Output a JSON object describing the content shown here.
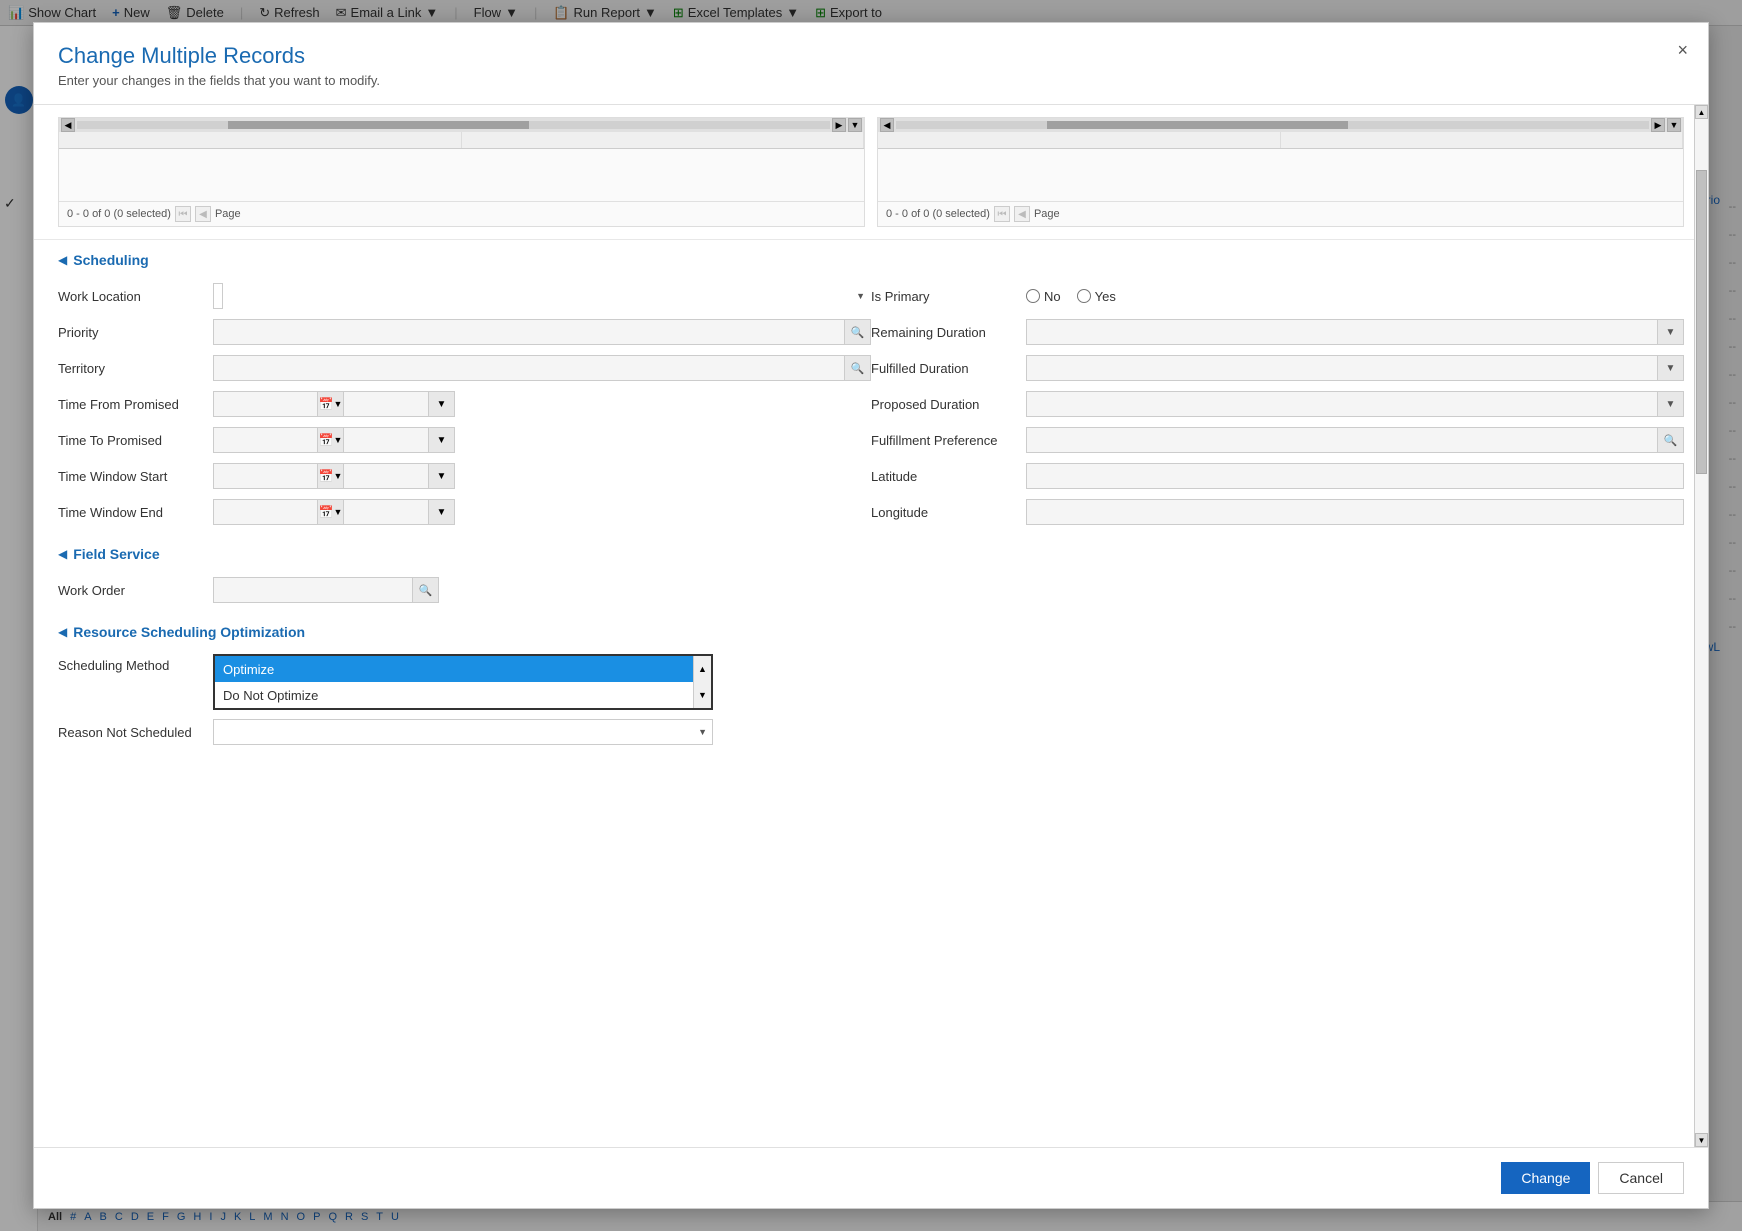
{
  "toolbar": {
    "show_chart": "Show Chart",
    "new": "New",
    "delete": "Delete",
    "refresh": "Refresh",
    "email_link": "Email a Link",
    "flow": "Flow",
    "run_report": "Run Report",
    "excel_templates": "Excel Templates",
    "export_to": "Export to"
  },
  "modal": {
    "title": "Change Multiple Records",
    "subtitle": "Enter your changes in the fields that you want to modify.",
    "close_label": "×",
    "lookup_panel1": {
      "pagination": "0 - 0 of 0 (0 selected)",
      "page_label": "Page"
    },
    "lookup_panel2": {
      "pagination": "0 - 0 of 0 (0 selected)",
      "page_label": "Page"
    },
    "sections": {
      "scheduling": {
        "title": "Scheduling",
        "fields": {
          "work_location": {
            "label": "Work Location",
            "value": ""
          },
          "is_primary": {
            "label": "Is Primary",
            "no_label": "No",
            "yes_label": "Yes"
          },
          "priority": {
            "label": "Priority",
            "value": ""
          },
          "remaining_duration": {
            "label": "Remaining Duration",
            "value": ""
          },
          "territory": {
            "label": "Territory",
            "value": ""
          },
          "fulfilled_duration": {
            "label": "Fulfilled Duration",
            "value": ""
          },
          "time_from_promised": {
            "label": "Time From Promised",
            "date_value": "",
            "time_value": ""
          },
          "proposed_duration": {
            "label": "Proposed Duration",
            "value": ""
          },
          "time_to_promised": {
            "label": "Time To Promised",
            "date_value": "",
            "time_value": ""
          },
          "fulfillment_preference": {
            "label": "Fulfillment Preference",
            "value": ""
          },
          "time_window_start": {
            "label": "Time Window Start",
            "date_value": "",
            "time_value": ""
          },
          "latitude": {
            "label": "Latitude",
            "value": ""
          },
          "time_window_end": {
            "label": "Time Window End",
            "date_value": "",
            "time_value": ""
          },
          "longitude": {
            "label": "Longitude",
            "value": ""
          }
        }
      },
      "field_service": {
        "title": "Field Service",
        "fields": {
          "work_order": {
            "label": "Work Order",
            "value": ""
          }
        }
      },
      "rso": {
        "title": "Resource Scheduling Optimization",
        "fields": {
          "scheduling_method": {
            "label": "Scheduling Method",
            "options": [
              "Optimize",
              "Do Not Optimize"
            ],
            "selected": "Optimize"
          },
          "reason_not_scheduled": {
            "label": "Reason Not Scheduled",
            "value": ""
          }
        }
      }
    },
    "footer": {
      "change_label": "Change",
      "cancel_label": "Cancel"
    }
  },
  "sidebar": {
    "check_icon": "✓"
  },
  "alpha_bar": {
    "current": "All",
    "letters": [
      "#",
      "A",
      "B",
      "C",
      "D",
      "E",
      "F",
      "G",
      "H",
      "I",
      "J",
      "K",
      "L",
      "M",
      "N",
      "O",
      "P",
      "Q",
      "R",
      "S",
      "T",
      "U"
    ]
  },
  "bg_col_labels": {
    "prio": "Prio",
    "lowl": "LowL"
  },
  "dashes": [
    "--",
    "--",
    "--",
    "--",
    "--",
    "--",
    "--",
    "--",
    "--",
    "--",
    "--",
    "--",
    "--",
    "--",
    "--",
    "--"
  ]
}
